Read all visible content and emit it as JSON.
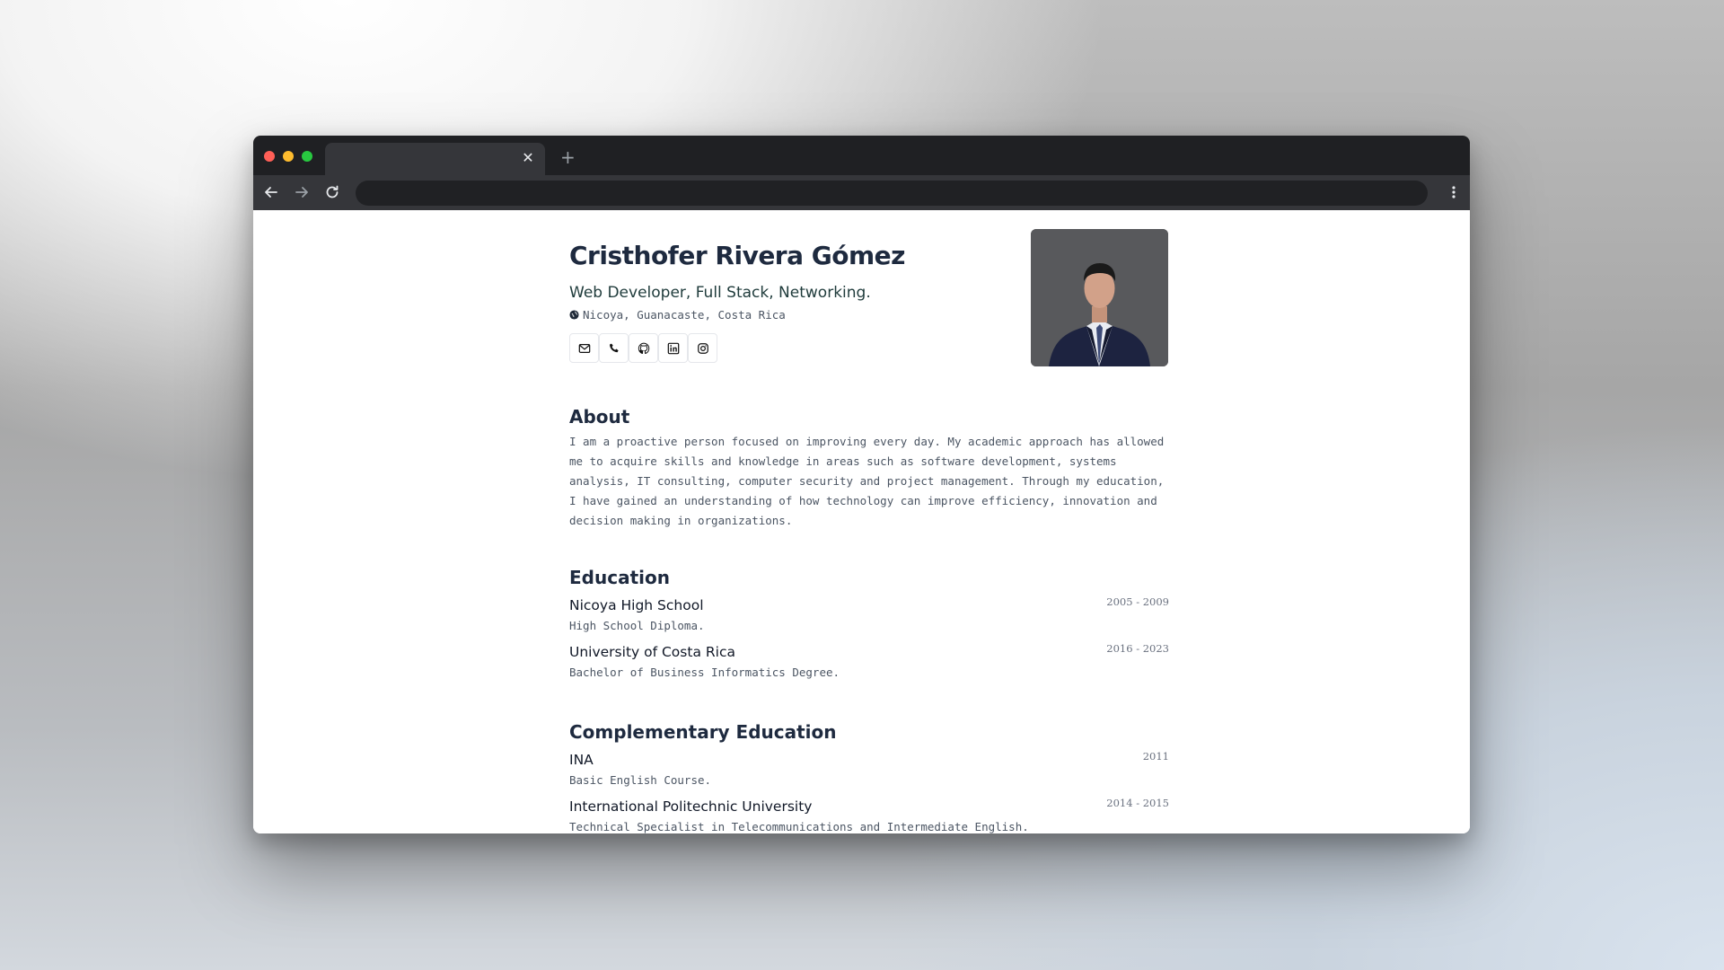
{
  "browser": {
    "tab_close": "✕",
    "new_tab": "+"
  },
  "profile": {
    "name": "Cristhofer Rivera Gómez",
    "headline": "Web Developer, Full Stack, Networking.",
    "location": "Nicoya, Guanacaste, Costa Rica"
  },
  "socials": [
    "mail-icon",
    "phone-icon",
    "github-icon",
    "linkedin-icon",
    "instagram-icon"
  ],
  "about": {
    "title": "About",
    "text": "I am a proactive person focused on improving every day. My academic approach has allowed me to acquire skills and knowledge in areas such as software development, systems analysis, IT consulting, computer security and project management. Through my education, I have gained an understanding of how technology can improve efficiency, innovation and decision making in organizations."
  },
  "education": {
    "title": "Education",
    "items": [
      {
        "school": "Nicoya High School",
        "degree": "High School Diploma.",
        "dates": "2005 - 2009"
      },
      {
        "school": "University of Costa Rica",
        "degree": "Bachelor of Business Informatics Degree.",
        "dates": "2016 - 2023"
      }
    ]
  },
  "complementary": {
    "title": "Complementary Education",
    "items": [
      {
        "school": "INA",
        "degree": "Basic English Course.",
        "dates": "2011"
      },
      {
        "school": "International Politechnic University",
        "degree": "Technical Specialist in Telecommunications and Intermediate English.",
        "dates": "2014 - 2015"
      }
    ]
  },
  "colors": {
    "heading": "#1e2a3f",
    "text_muted": "#4b5563",
    "browser_dark": "#1f2023",
    "browser_toolbar": "#35363a"
  }
}
